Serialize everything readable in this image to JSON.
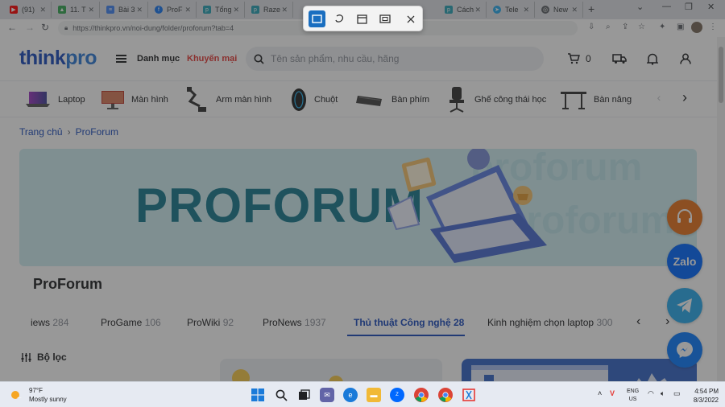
{
  "browser": {
    "tabs": [
      {
        "title": "(91)",
        "favicon_color": "#ff0000"
      },
      {
        "title": "11. T",
        "favicon_color": "#34a853"
      },
      {
        "title": "Bài 3",
        "favicon_color": "#4285f4"
      },
      {
        "title": "ProF",
        "favicon_color": "#1877f2"
      },
      {
        "title": "Tổng",
        "favicon_color": "#2aa3b6"
      },
      {
        "title": "Raze",
        "favicon_color": "#2aa3b6"
      },
      {
        "title": "Cách",
        "favicon_color": "#2aa3b6"
      },
      {
        "title": "Tele",
        "favicon_color": "#2aabee"
      },
      {
        "title": "New",
        "favicon_color": "#5f6368"
      }
    ],
    "new_tab": "+",
    "url": "https://thinkpro.vn/noi-dung/folder/proforum?tab=4"
  },
  "header": {
    "logo_think": "think",
    "logo_pro": "pro",
    "menu_label": "Danh mục",
    "promo_label": "Khuyến mại",
    "search_placeholder": "Tên sản phẩm, nhu cầu, hãng",
    "cart_count": "0"
  },
  "categories": [
    {
      "label": "Laptop"
    },
    {
      "label": "Màn hình"
    },
    {
      "label": "Arm màn hình"
    },
    {
      "label": "Chuột"
    },
    {
      "label": "Bàn phím"
    },
    {
      "label": "Ghế công thái học"
    },
    {
      "label": "Bàn nâng"
    }
  ],
  "breadcrumb": {
    "home": "Trang chủ",
    "current": "ProForum"
  },
  "banner": {
    "title": "PROFORUM",
    "watermark": "proforum"
  },
  "section_title": "ProForum",
  "content_tabs": [
    {
      "label": "iews",
      "count": "284"
    },
    {
      "label": "ProGame",
      "count": "106"
    },
    {
      "label": "ProWiki",
      "count": "92"
    },
    {
      "label": "ProNews",
      "count": "1937"
    },
    {
      "label": "Thủ thuật Công nghệ",
      "count": "28",
      "active": true
    },
    {
      "label": "Kinh nghiệm chọn laptop",
      "count": "300"
    }
  ],
  "filter_label": "Bộ lọc",
  "floating_buttons": [
    {
      "name": "support",
      "color": "#e8731d"
    },
    {
      "name": "zalo",
      "label": "Zalo",
      "color": "#0068ff"
    },
    {
      "name": "telegram",
      "color": "#2aabee"
    },
    {
      "name": "messenger",
      "color": "#0a7cff"
    }
  ],
  "taskbar": {
    "weather_temp": "97°F",
    "weather_desc": "Mostly sunny",
    "lang_line1": "ENG",
    "lang_line2": "US",
    "time": "4:54 PM",
    "date": "8/3/2022"
  }
}
